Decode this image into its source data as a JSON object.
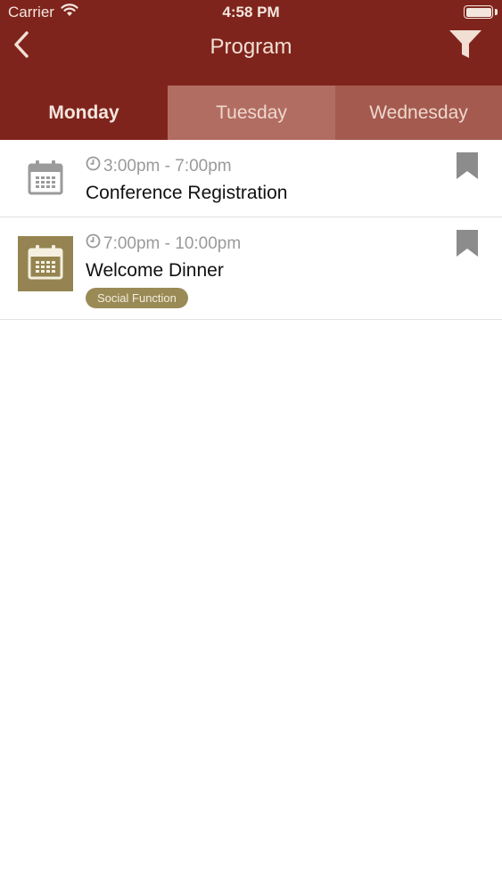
{
  "status_bar": {
    "carrier": "Carrier",
    "time": "4:58 PM",
    "icons": [
      "wifi-icon",
      "battery-icon"
    ]
  },
  "nav": {
    "title": "Program",
    "back_icon": "chevron-left-icon",
    "filter_icon": "filter-icon"
  },
  "tabs": [
    {
      "label": "Monday",
      "selected": true
    },
    {
      "label": "Tuesday",
      "selected": false
    },
    {
      "label": "Wednesday",
      "selected": false
    }
  ],
  "events": [
    {
      "time": "3:00pm - 7:00pm",
      "title": "Conference Registration",
      "icon": "calendar-icon",
      "bookmark_icon": "bookmark-icon"
    },
    {
      "time": "7:00pm - 10:00pm",
      "title": "Welcome Dinner",
      "icon": "calendar-icon",
      "bookmark_icon": "bookmark-icon",
      "tag": "Social Function"
    }
  ],
  "colors": {
    "header": "#7f241c",
    "tab_inactive": "#b26d62",
    "accent_olive": "#958451",
    "bookmark_gray": "#8c8c8c"
  }
}
